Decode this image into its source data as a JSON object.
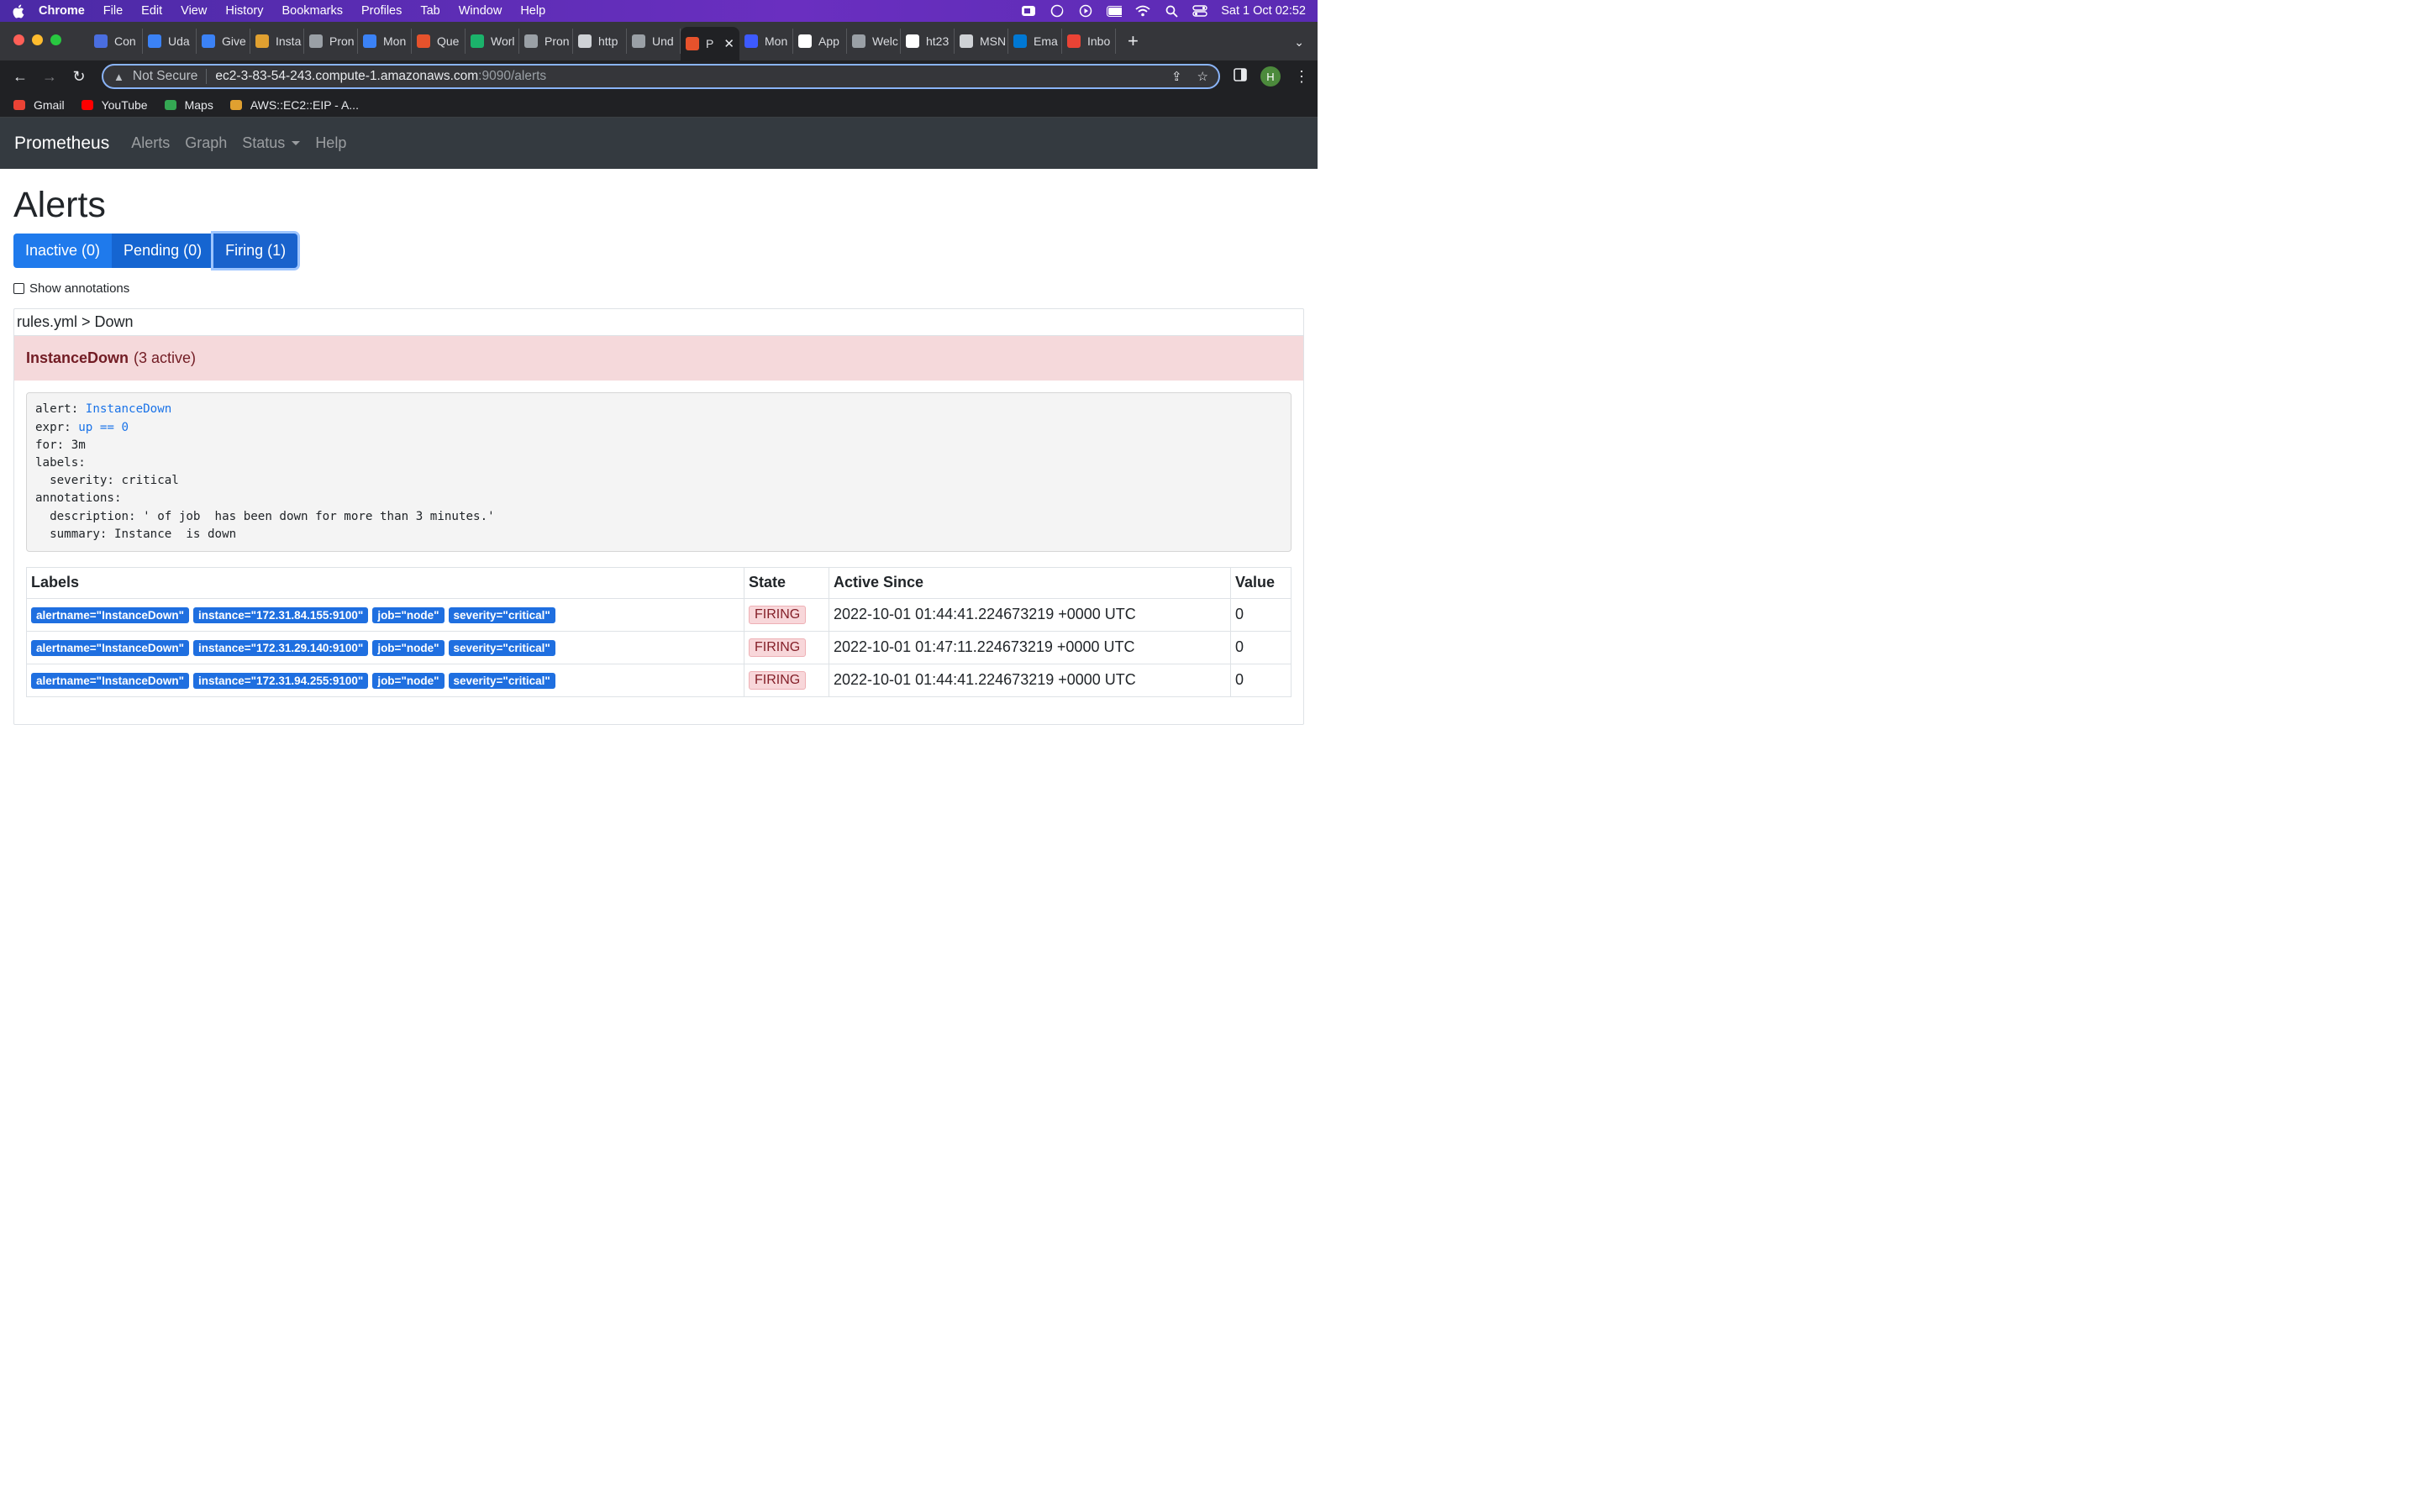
{
  "menubar": {
    "app": "Chrome",
    "items": [
      "File",
      "Edit",
      "View",
      "History",
      "Bookmarks",
      "Profiles",
      "Tab",
      "Window",
      "Help"
    ],
    "datetime": "Sat 1 Oct  02:52"
  },
  "tabs": [
    {
      "label": "Con",
      "color": "#4a6ee0"
    },
    {
      "label": "Uda",
      "color": "#3b82f6"
    },
    {
      "label": "Give",
      "color": "#3b82f6"
    },
    {
      "label": "Insta",
      "color": "#e0a030"
    },
    {
      "label": "Pron",
      "color": "#9aa0a6"
    },
    {
      "label": "Mon",
      "color": "#3b82f6"
    },
    {
      "label": "Que",
      "color": "#e6522c"
    },
    {
      "label": "Worl",
      "color": "#1bb36b"
    },
    {
      "label": "Pron",
      "color": "#9aa0a6"
    },
    {
      "label": "http",
      "color": "#cfd2d6"
    },
    {
      "label": "Und",
      "color": "#9aa0a6"
    },
    {
      "label": "P",
      "color": "#e6522c",
      "active": true
    },
    {
      "label": "Mon",
      "color": "#3d5afe"
    },
    {
      "label": "App",
      "color": "#ffffff"
    },
    {
      "label": "Welc",
      "color": "#9aa0a6"
    },
    {
      "label": "ht23",
      "color": "#ffffff"
    },
    {
      "label": "MSN",
      "color": "#cfd2d6"
    },
    {
      "label": "Ema",
      "color": "#0078d4"
    },
    {
      "label": "Inbo",
      "color": "#ea4335"
    }
  ],
  "address": {
    "security": "Not Secure",
    "host": "ec2-3-83-54-243.compute-1.amazonaws.com",
    "path": ":9090/alerts"
  },
  "profile_initial": "H",
  "bookmarks": [
    {
      "label": "Gmail",
      "color": "#ea4335"
    },
    {
      "label": "YouTube",
      "color": "#ff0000"
    },
    {
      "label": "Maps",
      "color": "#34a853"
    },
    {
      "label": "AWS::EC2::EIP - A...",
      "color": "#e0a030"
    }
  ],
  "nav": {
    "brand": "Prometheus",
    "links": [
      "Alerts",
      "Graph",
      "Status",
      "Help"
    ]
  },
  "page": {
    "title": "Alerts",
    "filters": {
      "inactive": "Inactive (0)",
      "pending": "Pending (0)",
      "firing": "Firing (1)"
    },
    "show_annotations": "Show annotations"
  },
  "group": {
    "name": "rules.yml > Down",
    "alert_name": "InstanceDown",
    "active_count": "(3 active)",
    "rule": {
      "alert_key": "alert: ",
      "alert_val": "InstanceDown",
      "expr_key": "expr: ",
      "expr_val": "up == 0",
      "for": "for: 3m",
      "labels": "labels:",
      "severity": "  severity: critical",
      "annotations": "annotations:",
      "description": "  description: ' of job  has been down for more than 3 minutes.'",
      "summary": "  summary: Instance  is down"
    }
  },
  "table": {
    "headers": [
      "Labels",
      "State",
      "Active Since",
      "Value"
    ],
    "rows": [
      {
        "labels": [
          "alertname=\"InstanceDown\"",
          "instance=\"172.31.84.155:9100\"",
          "job=\"node\"",
          "severity=\"critical\""
        ],
        "state": "FIRING",
        "since": "2022-10-01 01:44:41.224673219 +0000 UTC",
        "value": "0"
      },
      {
        "labels": [
          "alertname=\"InstanceDown\"",
          "instance=\"172.31.29.140:9100\"",
          "job=\"node\"",
          "severity=\"critical\""
        ],
        "state": "FIRING",
        "since": "2022-10-01 01:47:11.224673219 +0000 UTC",
        "value": "0"
      },
      {
        "labels": [
          "alertname=\"InstanceDown\"",
          "instance=\"172.31.94.255:9100\"",
          "job=\"node\"",
          "severity=\"critical\""
        ],
        "state": "FIRING",
        "since": "2022-10-01 01:44:41.224673219 +0000 UTC",
        "value": "0"
      }
    ]
  }
}
